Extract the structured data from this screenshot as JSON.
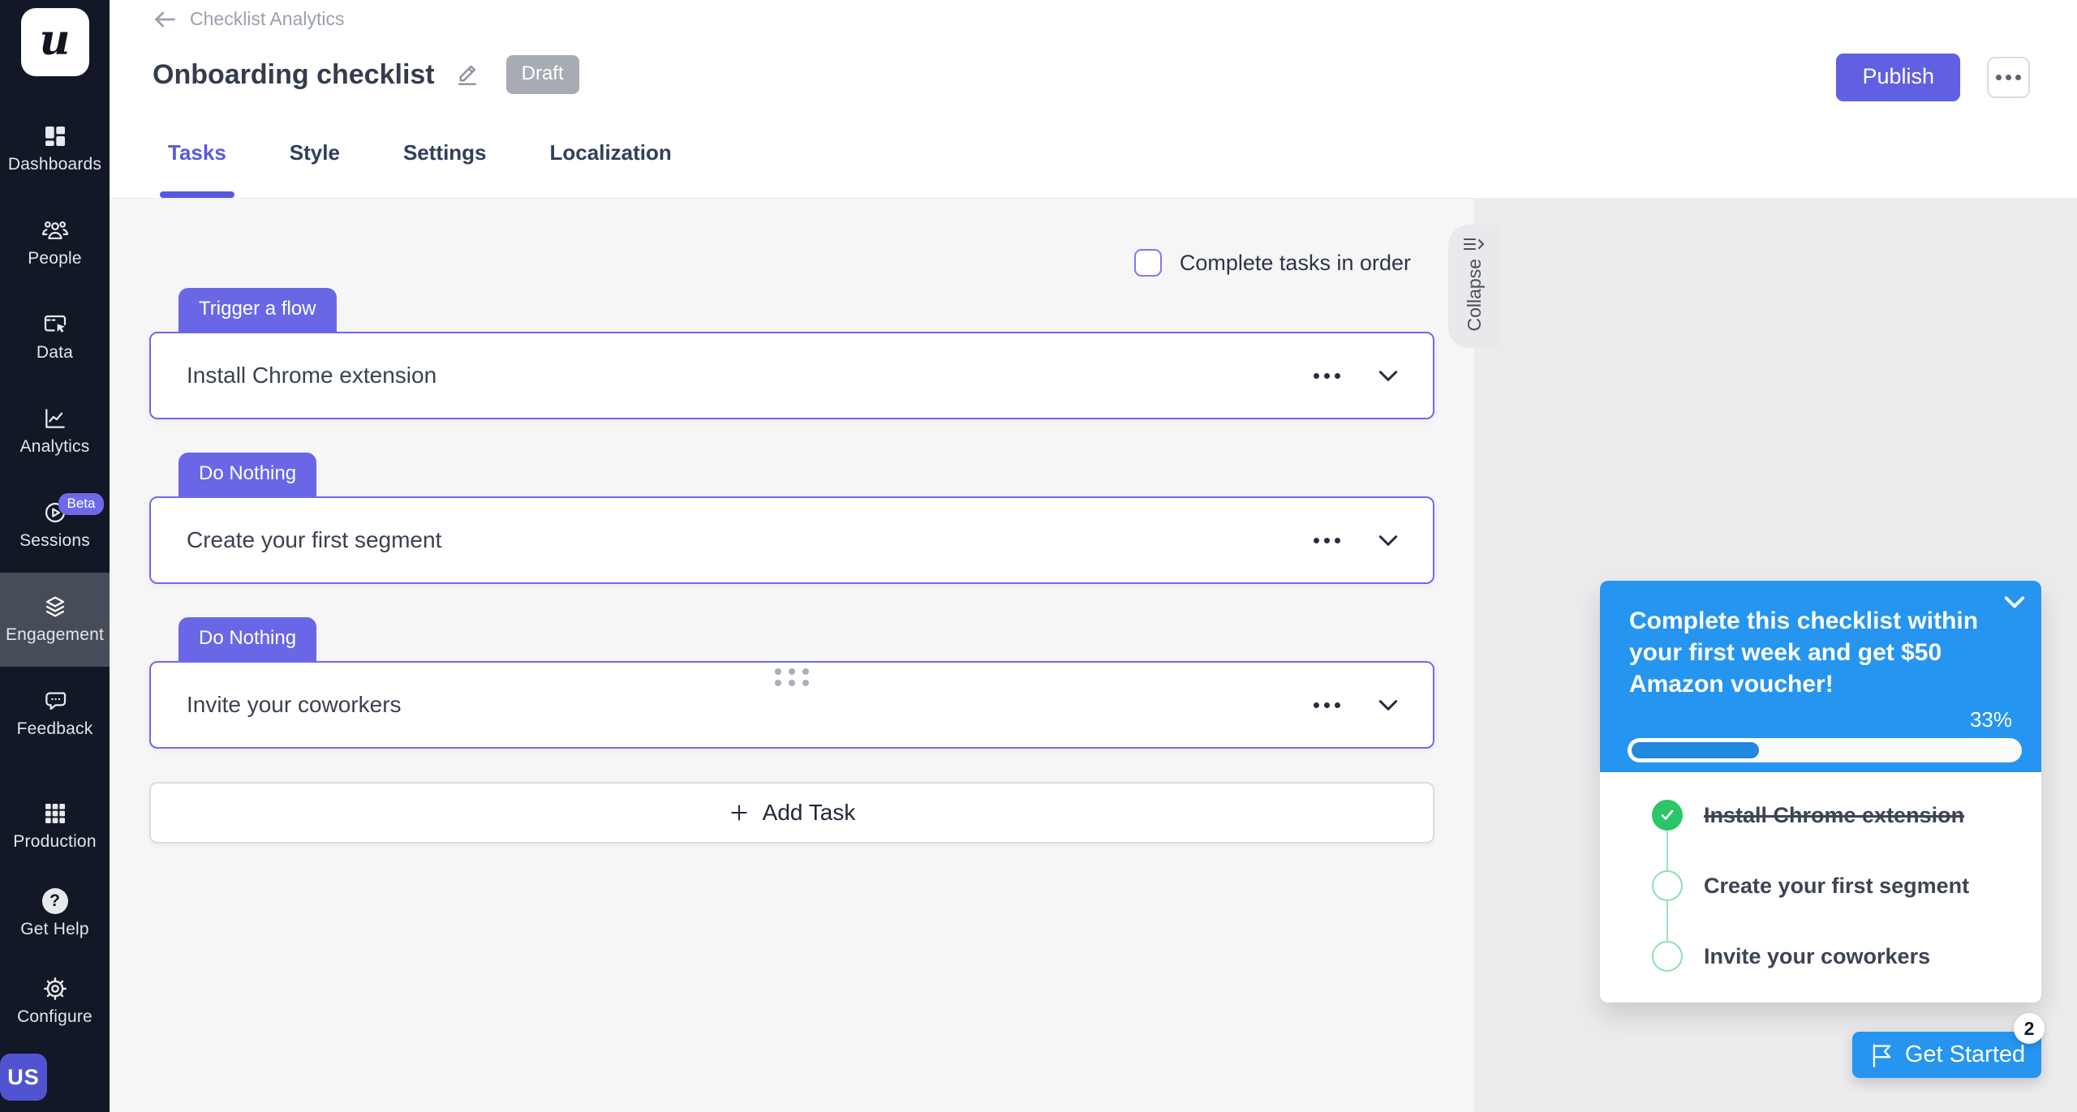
{
  "colors": {
    "brand_purple": "#615fe2",
    "task_border_purple": "#6d6aec",
    "preview_blue": "#2595f0",
    "progress_fill_blue": "#2287de",
    "success_green": "#2bc56a",
    "sidebar_bg": "#121826",
    "draft_gray": "#a7abb3"
  },
  "sidebar": {
    "logo_letter": "u",
    "items": [
      {
        "label": "Dashboards"
      },
      {
        "label": "People"
      },
      {
        "label": "Data"
      },
      {
        "label": "Analytics"
      },
      {
        "label": "Sessions",
        "badge": "Beta"
      },
      {
        "label": "Engagement",
        "active": true
      },
      {
        "label": "Feedback"
      },
      {
        "label": "Production"
      },
      {
        "label": "Get Help"
      },
      {
        "label": "Configure"
      }
    ],
    "avatar_initials": "US"
  },
  "header": {
    "breadcrumb": "Checklist Analytics",
    "title": "Onboarding checklist",
    "status_badge": "Draft",
    "publish_label": "Publish",
    "active_tab": "Tasks",
    "tabs": [
      {
        "label": "Tasks"
      },
      {
        "label": "Style"
      },
      {
        "label": "Settings"
      },
      {
        "label": "Localization"
      }
    ]
  },
  "editor": {
    "order_checkbox_label": "Complete tasks in order",
    "order_checkbox_checked": false,
    "tasks": [
      {
        "trigger_badge": "Trigger a flow",
        "title": "Install Chrome extension"
      },
      {
        "trigger_badge": "Do Nothing",
        "title": "Create your first segment"
      },
      {
        "trigger_badge": "Do Nothing",
        "title": "Invite your coworkers"
      }
    ],
    "add_task_label": "Add Task",
    "collapse_label": "Collapse"
  },
  "preview": {
    "headline": "Complete this checklist within your first week and get $50 Amazon voucher!",
    "progress_label": "33%",
    "progress_fill_width": "33%",
    "items": [
      {
        "label": "Install Chrome extension",
        "completed": true
      },
      {
        "label": "Create your first segment",
        "completed": false
      },
      {
        "label": "Invite your coworkers",
        "completed": false
      }
    ],
    "launcher_label": "Get Started",
    "launcher_badge_count": "2"
  }
}
